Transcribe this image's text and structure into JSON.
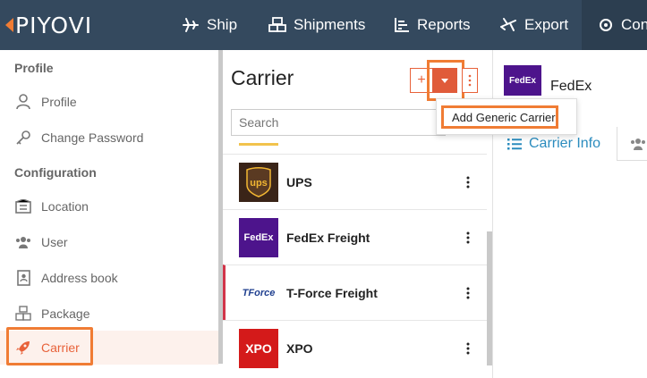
{
  "app": {
    "logo_text": "PIYOVI"
  },
  "nav": {
    "ship": "Ship",
    "shipments": "Shipments",
    "reports": "Reports",
    "export": "Export",
    "configuration": "Con"
  },
  "sidebar": {
    "section_profile": "Profile",
    "section_configuration": "Configuration",
    "items": [
      {
        "label": "Profile",
        "icon": "user-icon"
      },
      {
        "label": "Change Password",
        "icon": "key-icon"
      },
      {
        "label": "Location",
        "icon": "building-icon"
      },
      {
        "label": "User",
        "icon": "users-icon"
      },
      {
        "label": "Address book",
        "icon": "address-book-icon"
      },
      {
        "label": "Package",
        "icon": "package-icon"
      },
      {
        "label": "Carrier",
        "icon": "rocket-icon",
        "active": true
      }
    ]
  },
  "carrier_list": {
    "title": "Carrier",
    "add_label": "+",
    "search_placeholder": "Search",
    "rows": [
      {
        "name": "UPS",
        "logo_text": "ups"
      },
      {
        "name": "FedEx Freight",
        "logo_text": "FedEx"
      },
      {
        "name": "T-Force Freight",
        "logo_text": "TForce"
      },
      {
        "name": "XPO",
        "logo_text": "XPO"
      }
    ]
  },
  "dropdown": {
    "items": [
      "Add Generic Carrier"
    ]
  },
  "detail": {
    "carrier_name": "FedEx",
    "logo_text": "FedEx",
    "tabs": [
      {
        "label": "Carrier Info"
      }
    ]
  },
  "colors": {
    "topbar": "#34495e",
    "accent": "#e8623a",
    "highlight": "#f07c34",
    "fedex_purple": "#4d148c",
    "tab_blue": "#2b8cbe"
  }
}
